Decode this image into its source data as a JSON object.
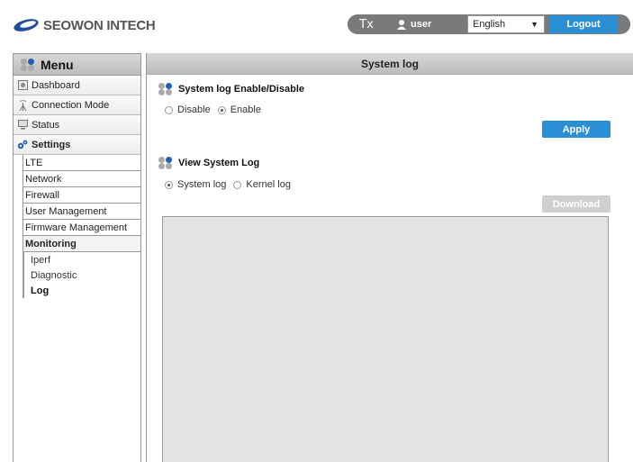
{
  "brand": {
    "name": "SEOWON INTECH"
  },
  "topbar": {
    "clear_label": "Tx",
    "user_label": "user",
    "language": "English",
    "logout_label": "Logout"
  },
  "menu": {
    "title": "Menu",
    "items": [
      {
        "label": "Dashboard",
        "icon": "dashboard-icon"
      },
      {
        "label": "Connection Mode",
        "icon": "antenna-icon"
      },
      {
        "label": "Status",
        "icon": "monitor-icon"
      },
      {
        "label": "Settings",
        "icon": "gears-icon"
      }
    ],
    "settings_sub": [
      {
        "label": "LTE"
      },
      {
        "label": "Network"
      },
      {
        "label": "Firewall"
      },
      {
        "label": "User Management"
      },
      {
        "label": "Firmware Management"
      },
      {
        "label": "Monitoring"
      }
    ],
    "monitoring_sub": [
      {
        "label": "Iperf"
      },
      {
        "label": "Diagnostic"
      },
      {
        "label": "Log"
      }
    ]
  },
  "main": {
    "title": "System log",
    "enable_section": {
      "title": "System log Enable/Disable",
      "options": [
        "Disable",
        "Enable"
      ],
      "selected": "Enable",
      "apply_label": "Apply"
    },
    "view_section": {
      "title": "View System Log",
      "options": [
        "System log",
        "Kernel log"
      ],
      "selected": "System log",
      "download_label": "Download"
    }
  },
  "colors": {
    "accent": "#2b8fd6",
    "pill": "#7a7a7a",
    "disabled": "#cfcfcf"
  }
}
